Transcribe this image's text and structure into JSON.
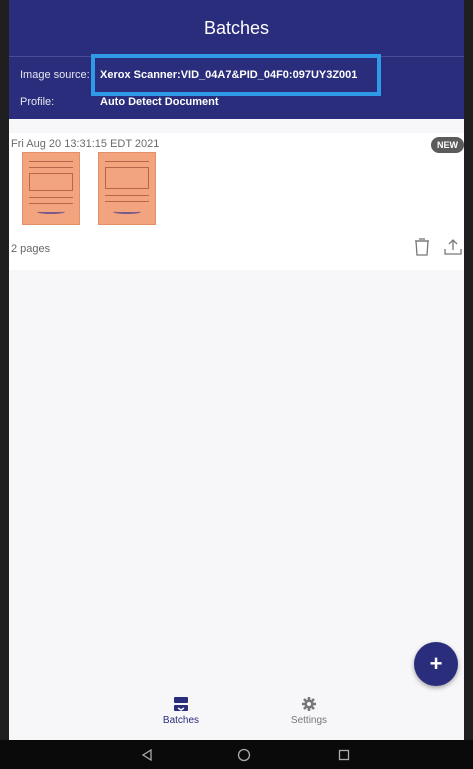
{
  "app": {
    "title": "Batches"
  },
  "info": {
    "image_source_label": "Image source:",
    "image_source_value": "Xerox Scanner:VID_04A7&PID_04F0:097UY3Z001",
    "profile_label": "Profile:",
    "profile_value": "Auto Detect Document"
  },
  "batch": {
    "date": "Fri Aug 20 13:31:15 EDT 2021",
    "badge": "NEW",
    "pages": "2 pages",
    "thumbnail_color": "#f2a47e"
  },
  "fab": {
    "label": "+"
  },
  "nav": {
    "batches_label": "Batches",
    "settings_label": "Settings",
    "active": "Batches"
  },
  "colors": {
    "primary": "#2a2d7c",
    "highlight": "#2f9be8",
    "badge": "#5b5b5b"
  },
  "icons": [
    "delete-icon",
    "export-icon",
    "batches-icon",
    "settings-gear-icon",
    "back-icon",
    "home-icon",
    "recents-icon"
  ]
}
